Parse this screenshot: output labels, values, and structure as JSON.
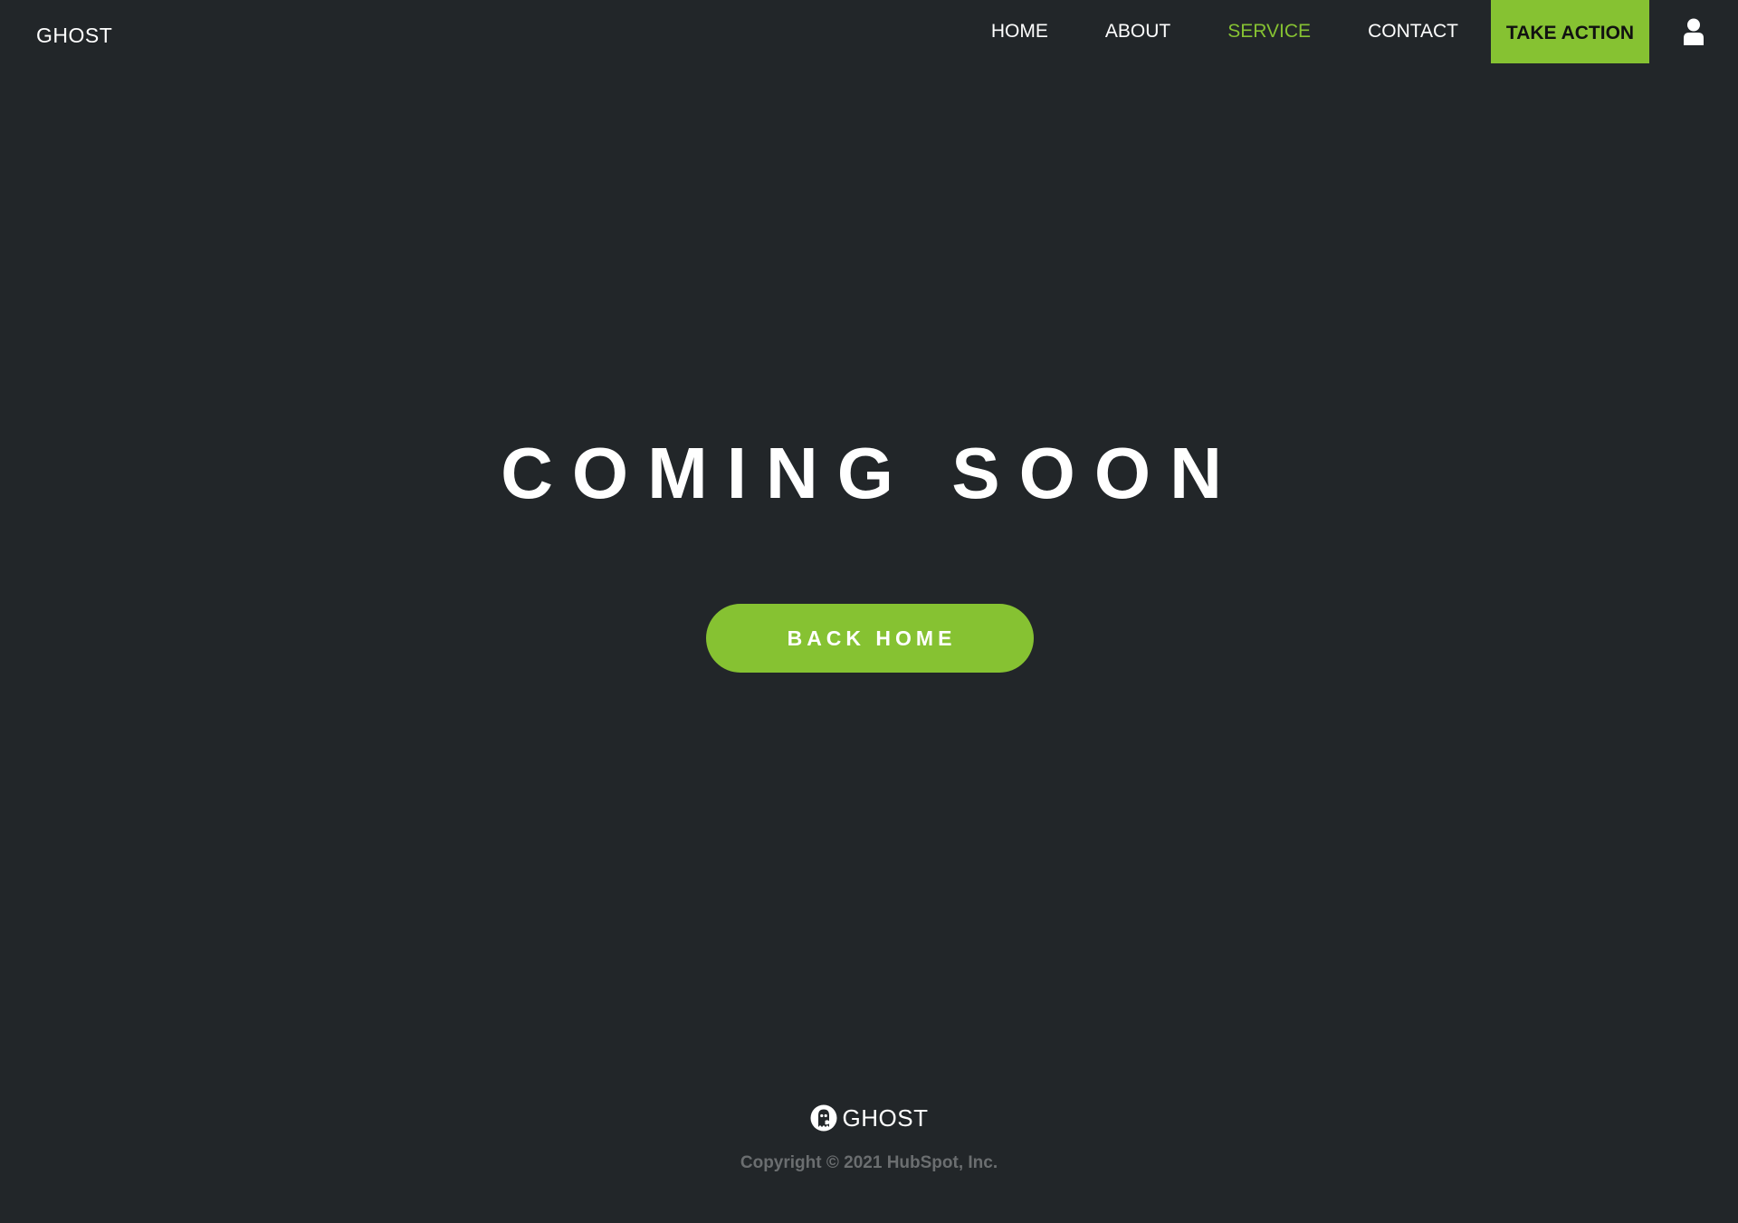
{
  "header": {
    "brand": "GHOST",
    "nav": {
      "home": "HOME",
      "about": "ABOUT",
      "service": "SERVICE",
      "contact": "CONTACT"
    },
    "active_item": "SERVICE",
    "cta_label": "TAKE ACTION",
    "user_icon": "user-icon"
  },
  "hero": {
    "title": "COMING SOON",
    "button_label": "BACK HOME"
  },
  "footer": {
    "logo_icon": "ghost-logo-icon",
    "brand": "GHOST",
    "copyright": "Copyright © 2021 HubSpot, Inc."
  },
  "colors": {
    "background": "#222629",
    "accent": "#86c232",
    "text": "#ffffff",
    "muted": "#6b6e70"
  }
}
